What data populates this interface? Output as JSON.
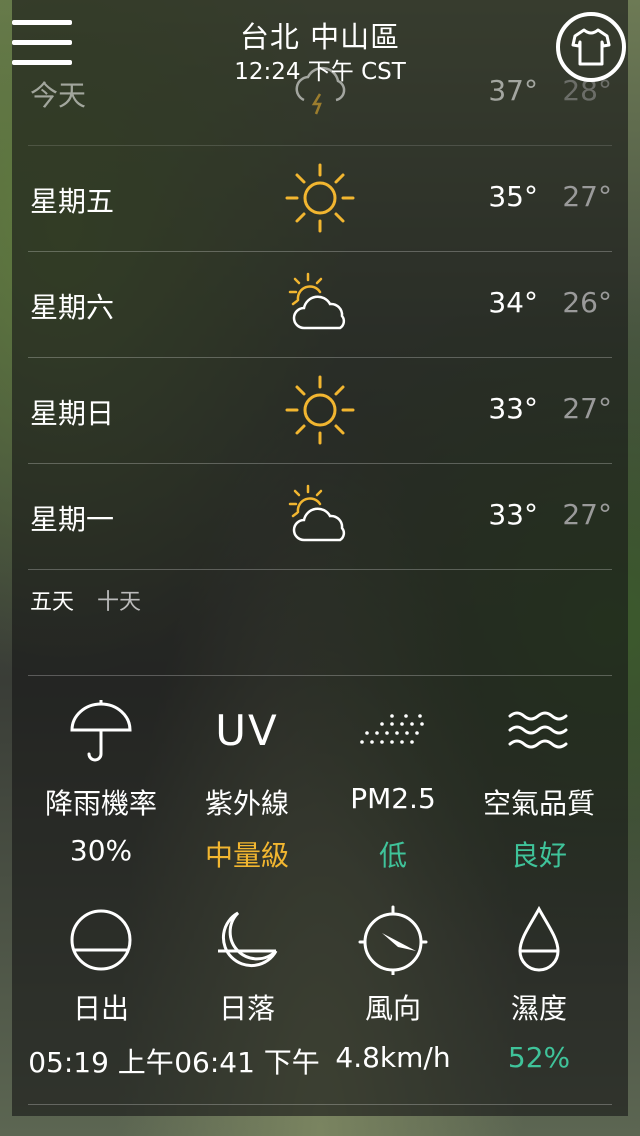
{
  "header": {
    "location": "台北 中山區",
    "time": "12:24 下午 CST",
    "menu_icon": "menu-icon",
    "shirt_icon": "shirt-icon"
  },
  "forecast": [
    {
      "day": "今天",
      "icon": "thunderstorm-icon",
      "high": "37°",
      "low": "28°"
    },
    {
      "day": "星期五",
      "icon": "sun-icon",
      "high": "35°",
      "low": "27°"
    },
    {
      "day": "星期六",
      "icon": "partly-cloudy-icon",
      "high": "34°",
      "low": "26°"
    },
    {
      "day": "星期日",
      "icon": "sun-icon",
      "high": "33°",
      "low": "27°"
    },
    {
      "day": "星期一",
      "icon": "partly-cloudy-icon",
      "high": "33°",
      "low": "27°"
    }
  ],
  "toggle": {
    "five_days": "五天",
    "ten_days": "十天"
  },
  "details_row1": [
    {
      "label": "降雨機率",
      "value": "30%",
      "icon": "umbrella-icon",
      "color": "#ffffff"
    },
    {
      "label": "紫外線",
      "value": "中量級",
      "icon": "uv-icon",
      "icon_text": "UV",
      "color": "#f2b630"
    },
    {
      "label": "PM2.5",
      "value": "低",
      "icon": "pm25-icon",
      "color": "#3fc39a"
    },
    {
      "label": "空氣品質",
      "value": "良好",
      "icon": "air-waves-icon",
      "color": "#3fc39a"
    }
  ],
  "details_row2": [
    {
      "label": "日出",
      "value": "05:19 上午",
      "icon": "sunrise-icon",
      "color": "#ffffff"
    },
    {
      "label": "日落",
      "value": "06:41 下午",
      "icon": "moon-icon",
      "color": "#ffffff"
    },
    {
      "label": "風向",
      "value": "4.8km/h",
      "icon": "compass-icon",
      "color": "#ffffff"
    },
    {
      "label": "濕度",
      "value": "52%",
      "icon": "drop-icon",
      "color": "#3fc39a"
    }
  ]
}
